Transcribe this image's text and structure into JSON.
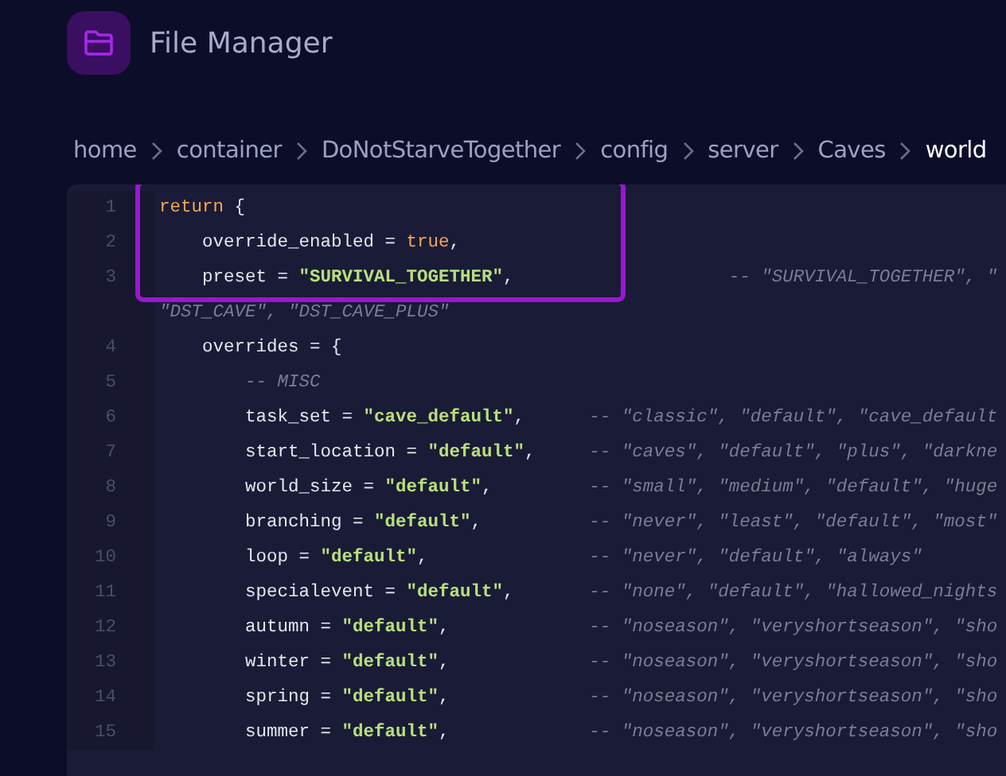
{
  "app": {
    "title": "File Manager"
  },
  "breadcrumb": [
    {
      "label": "home",
      "current": false
    },
    {
      "label": "container",
      "current": false
    },
    {
      "label": "DoNotStarveTogether",
      "current": false
    },
    {
      "label": "config",
      "current": false
    },
    {
      "label": "server",
      "current": false
    },
    {
      "label": "Caves",
      "current": false
    },
    {
      "label": "world",
      "current": true
    }
  ],
  "editor": {
    "lines": [
      {
        "number": "1",
        "highlighted": true,
        "tokens": [
          {
            "kind": "keyword",
            "text": "return"
          },
          {
            "kind": "plain",
            "text": " {"
          }
        ]
      },
      {
        "number": "2",
        "highlighted": true,
        "tokens": [
          {
            "kind": "plain",
            "text": "    override_enabled = "
          },
          {
            "kind": "bool",
            "text": "true"
          },
          {
            "kind": "plain",
            "text": ","
          }
        ]
      },
      {
        "number": "3",
        "highlighted": true,
        "tokens": [
          {
            "kind": "plain",
            "text": "    preset = "
          },
          {
            "kind": "string",
            "text": "\"SURVIVAL_TOGETHER\""
          },
          {
            "kind": "plain",
            "text": ",                    "
          },
          {
            "kind": "comment",
            "text": "-- \"SURVIVAL_TOGETHER\", \""
          }
        ],
        "wrap_tokens": [
          {
            "kind": "comment",
            "text": "\"DST_CAVE\", \"DST_CAVE_PLUS\""
          }
        ]
      },
      {
        "number": "4",
        "highlighted": false,
        "tokens": [
          {
            "kind": "plain",
            "text": "    overrides = {"
          }
        ]
      },
      {
        "number": "5",
        "highlighted": false,
        "tokens": [
          {
            "kind": "comment",
            "text": "        -- MISC"
          }
        ]
      },
      {
        "number": "6",
        "highlighted": false,
        "tokens": [
          {
            "kind": "plain",
            "text": "        task_set = "
          },
          {
            "kind": "string",
            "text": "\"cave_default\""
          },
          {
            "kind": "plain",
            "text": ",      "
          },
          {
            "kind": "comment",
            "text": "-- \"classic\", \"default\", \"cave_default"
          }
        ]
      },
      {
        "number": "7",
        "highlighted": false,
        "tokens": [
          {
            "kind": "plain",
            "text": "        start_location = "
          },
          {
            "kind": "string",
            "text": "\"default\""
          },
          {
            "kind": "plain",
            "text": ",     "
          },
          {
            "kind": "comment",
            "text": "-- \"caves\", \"default\", \"plus\", \"darkne"
          }
        ]
      },
      {
        "number": "8",
        "highlighted": false,
        "tokens": [
          {
            "kind": "plain",
            "text": "        world_size = "
          },
          {
            "kind": "string",
            "text": "\"default\""
          },
          {
            "kind": "plain",
            "text": ",         "
          },
          {
            "kind": "comment",
            "text": "-- \"small\", \"medium\", \"default\", \"huge"
          }
        ]
      },
      {
        "number": "9",
        "highlighted": false,
        "tokens": [
          {
            "kind": "plain",
            "text": "        branching = "
          },
          {
            "kind": "string",
            "text": "\"default\""
          },
          {
            "kind": "plain",
            "text": ",          "
          },
          {
            "kind": "comment",
            "text": "-- \"never\", \"least\", \"default\", \"most\""
          }
        ]
      },
      {
        "number": "10",
        "highlighted": false,
        "tokens": [
          {
            "kind": "plain",
            "text": "        loop = "
          },
          {
            "kind": "string",
            "text": "\"default\""
          },
          {
            "kind": "plain",
            "text": ",               "
          },
          {
            "kind": "comment",
            "text": "-- \"never\", \"default\", \"always\""
          }
        ]
      },
      {
        "number": "11",
        "highlighted": false,
        "tokens": [
          {
            "kind": "plain",
            "text": "        specialevent = "
          },
          {
            "kind": "string",
            "text": "\"default\""
          },
          {
            "kind": "plain",
            "text": ",       "
          },
          {
            "kind": "comment",
            "text": "-- \"none\", \"default\", \"hallowed_nights"
          }
        ]
      },
      {
        "number": "12",
        "highlighted": false,
        "tokens": [
          {
            "kind": "plain",
            "text": "        autumn = "
          },
          {
            "kind": "string",
            "text": "\"default\""
          },
          {
            "kind": "plain",
            "text": ",             "
          },
          {
            "kind": "comment",
            "text": "-- \"noseason\", \"veryshortseason\", \"sho"
          }
        ]
      },
      {
        "number": "13",
        "highlighted": false,
        "tokens": [
          {
            "kind": "plain",
            "text": "        winter = "
          },
          {
            "kind": "string",
            "text": "\"default\""
          },
          {
            "kind": "plain",
            "text": ",             "
          },
          {
            "kind": "comment",
            "text": "-- \"noseason\", \"veryshortseason\", \"sho"
          }
        ]
      },
      {
        "number": "14",
        "highlighted": false,
        "tokens": [
          {
            "kind": "plain",
            "text": "        spring = "
          },
          {
            "kind": "string",
            "text": "\"default\""
          },
          {
            "kind": "plain",
            "text": ",             "
          },
          {
            "kind": "comment",
            "text": "-- \"noseason\", \"veryshortseason\", \"sho"
          }
        ]
      },
      {
        "number": "15",
        "highlighted": false,
        "tokens": [
          {
            "kind": "plain",
            "text": "        summer = "
          },
          {
            "kind": "string",
            "text": "\"default\""
          },
          {
            "kind": "plain",
            "text": ",             "
          },
          {
            "kind": "comment",
            "text": "-- \"noseason\", \"veryshortseason\", \"sho"
          }
        ]
      }
    ]
  }
}
